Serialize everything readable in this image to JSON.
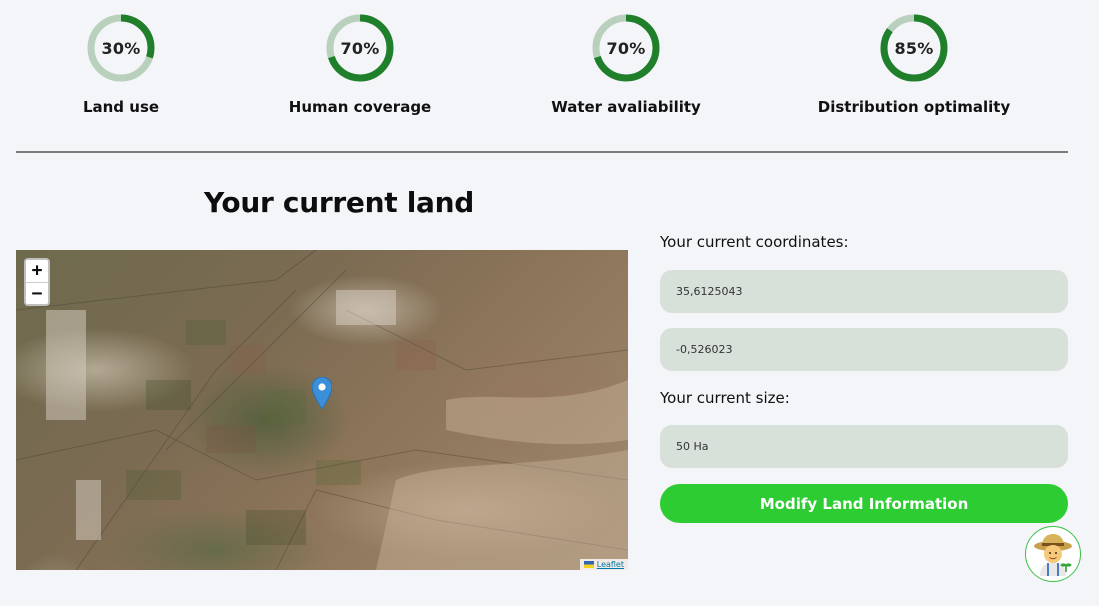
{
  "stats": [
    {
      "value": "30%",
      "label": "Land use",
      "percent": 30
    },
    {
      "value": "70%",
      "label": "Human coverage",
      "percent": 70
    },
    {
      "value": "70%",
      "label": "Water avaliability",
      "percent": 70
    },
    {
      "value": "85%",
      "label": "Distribution optimality",
      "percent": 85
    }
  ],
  "colors": {
    "ring_track": "#b8d0bc",
    "ring_fill": "#1f7f2a",
    "button": "#2ecc33",
    "field_bg": "#d8e0da"
  },
  "section": {
    "title": "Your current land"
  },
  "map": {
    "zoom_in": "+",
    "zoom_out": "−",
    "attribution": "Leaflet",
    "marker_icon": "map-pin-icon"
  },
  "form": {
    "coordinates_label": "Your current coordinates:",
    "latitude": "35,6125043",
    "longitude": "-0,526023",
    "size_label": "Your current size:",
    "size": "50 Ha",
    "modify_button": "Modify Land Information"
  },
  "assistant": {
    "icon": "farmer-avatar-icon"
  }
}
